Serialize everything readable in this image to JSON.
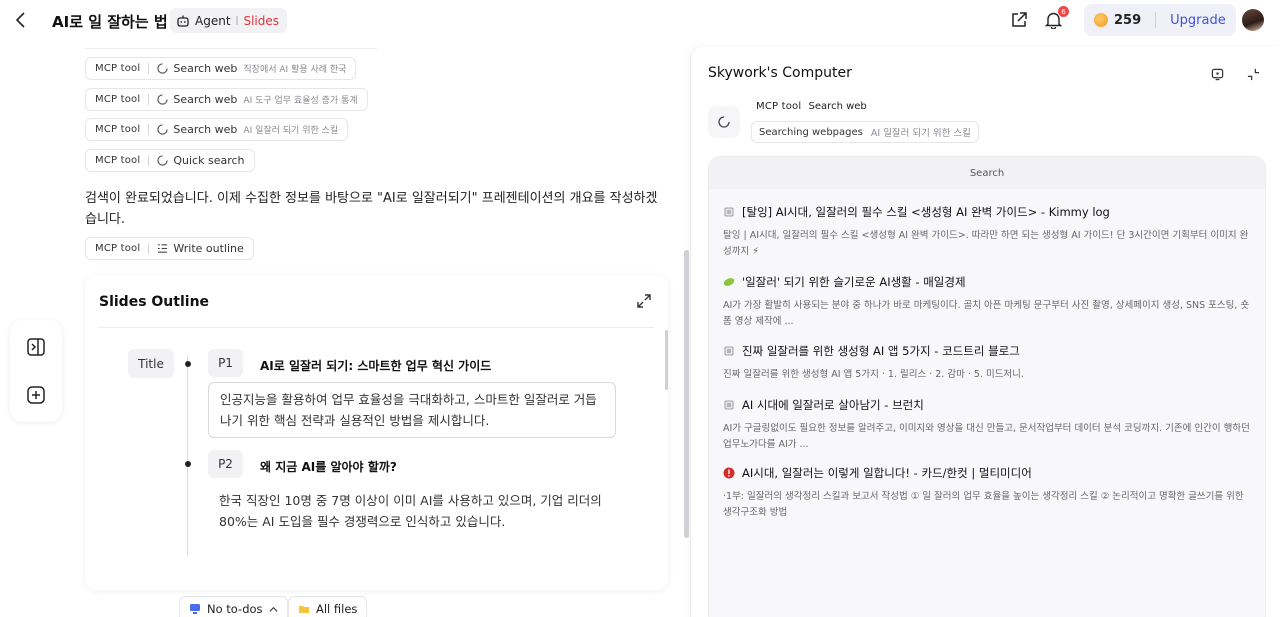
{
  "header": {
    "title": "AI로 일 잘하는 법",
    "mode_label": "Agent",
    "mode_sub": "Slides",
    "notification_count": "6",
    "credits": "259",
    "upgrade": "Upgrade"
  },
  "chat": {
    "tool_calls": [
      {
        "tool": "MCP tool",
        "action": "Search web",
        "query": "직장에서 AI 활용 사례 한국"
      },
      {
        "tool": "MCP tool",
        "action": "Search web",
        "query": "AI 도구 업무 효율성 증가 통계"
      },
      {
        "tool": "MCP tool",
        "action": "Search web",
        "query": "AI 일잘러 되기 위한 스킬"
      },
      {
        "tool": "MCP tool",
        "action": "Quick search",
        "query": ""
      }
    ],
    "message": "검색이 완료되었습니다. 이제 수집한 정보를 바탕으로 \"AI로 일잘러되기\" 프레젠테이션의 개요를 작성하겠습니다.",
    "outline_tool": {
      "tool": "MCP tool",
      "action": "Write outline"
    }
  },
  "outline": {
    "title": "Slides Outline",
    "title_tag": "Title",
    "slides": [
      {
        "page": "P1",
        "heading": "AI로 일잘러 되기: 스마트한 업무 혁신 가이드",
        "body": "인공지능을 활용하여 업무 효율성을 극대화하고, 스마트한 일잘러로 거듭나기 위한 핵심 전략과 실용적인 방법을 제시합니다."
      },
      {
        "page": "P2",
        "heading": "왜 지금 AI를 알아야 할까?",
        "body": "한국 직장인 10명 중 7명 이상이 이미 AI를 사용하고 있으며, 기업 리더의 80%는 AI 도입을 필수 경쟁력으로 인식하고 있습니다."
      }
    ]
  },
  "bottom": {
    "todos": "No to-dos",
    "files": "All files"
  },
  "computer": {
    "title": "Skywork's Computer",
    "status_tool": "MCP tool",
    "status_action": "Search web",
    "status_label": "Searching webpages",
    "status_query": "AI 일잘러 되기 위한 스킬",
    "browser_label": "Search",
    "results": [
      {
        "icon": "doc-icon",
        "title": "[탈잉] AI시대, 일잘러의 필수 스킬 <생성형 AI 완벽 가이드> - Kimmy log",
        "desc": "탈잉 | AI시대, 일잘러의 필수 스킬 <생성형 AI 완벽 가이드>. 따라만 하면 되는 생성형 AI 가이드! 단 3시간이면 기획부터 이미지 완성까지 ⚡"
      },
      {
        "icon": "leaf-icon",
        "title": "'일잘러' 되기 위한 슬기로운 AI생활 - 매일경제",
        "desc": "AI가 가장 활발히 사용되는 분야 중 하나가 바로 마케팅이다. 골치 아픈 마케팅 문구부터 사진 촬영, 상세페이지 생성, SNS 포스팅, 숏폼 영상 제작에 ..."
      },
      {
        "icon": "doc-icon",
        "title": "진짜 일잘러를 위한 생성형 AI 앱 5가지 - 코드트리 블로그",
        "desc": "진짜 일잘러를 위한 생성형 AI 앱 5가지 · 1. 릴리스 · 2. 감마 · 5. 미드저니."
      },
      {
        "icon": "doc-icon",
        "title": "AI 시대에 일잘러로 살아남기 - 브런치",
        "desc": "AI가 구글링없이도 필요한 정보를 알려주고, 이미지와 영상을 대신 만들고, 문서작업부터 데이터 분석 코딩까지. 기존에 인간이 행하던 업무노가다를 AI가 ..."
      },
      {
        "icon": "alert-icon",
        "title": "AI시대, 일잘러는 이렇게 일합니다! - 카드/한컷 | 멀티미디어",
        "desc": "·1부: 일잘러의 생각정리 스킬과 보고서 작성법 ① 일 잘러의 업무 효율을 높이는 생각정리 스킬 ② 논리적이고 명확한 글쓰기를 위한 생각구조화 방법"
      }
    ]
  }
}
